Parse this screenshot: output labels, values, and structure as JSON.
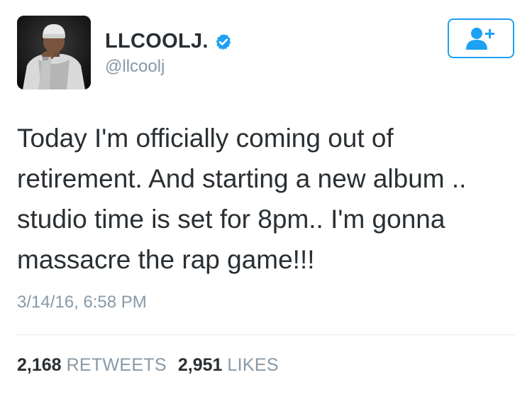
{
  "user": {
    "display_name": "LLCOOLJ.",
    "handle": "@llcoolj",
    "verified": true,
    "avatar_icon": "profile-photo"
  },
  "follow_button": {
    "icon": "add-user-icon",
    "color": "#1da1f2"
  },
  "tweet": {
    "text": "Today I'm officially coming out of\nretirement. And starting a new album ..\nstudio time is set for 8pm.. I'm gonna\nmassacre the rap game!!!",
    "timestamp": "3/14/16, 6:58 PM"
  },
  "stats": {
    "retweets_count": "2,168",
    "retweets_label": "RETWEETS",
    "likes_count": "2,951",
    "likes_label": "LIKES"
  },
  "colors": {
    "text": "#292f33",
    "secondary": "#8899a6",
    "accent": "#1da1f2",
    "divider": "#e1e8ed"
  }
}
